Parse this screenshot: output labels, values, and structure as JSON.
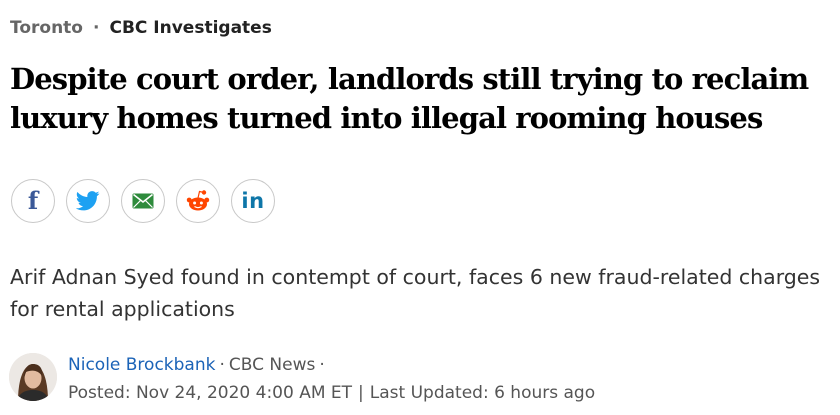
{
  "breadcrumb": {
    "region": "Toronto",
    "separator": "·",
    "section": "CBC Investigates"
  },
  "headline": "Despite court order, landlords still trying to reclaim luxury homes turned into illegal rooming houses",
  "share": {
    "buttons": [
      {
        "name": "facebook",
        "icon": "facebook-icon",
        "color": "#3b5998"
      },
      {
        "name": "twitter",
        "icon": "twitter-icon",
        "color": "#1da1f2"
      },
      {
        "name": "email",
        "icon": "email-icon",
        "color": "#2e8b3c"
      },
      {
        "name": "reddit",
        "icon": "reddit-icon",
        "color": "#ff4500"
      },
      {
        "name": "linkedin",
        "icon": "linkedin-icon",
        "color": "#0e76a8"
      }
    ]
  },
  "deck": "Arif Adnan Syed found in contempt of court, faces 6 new fraud-related charges for rental applications",
  "byline": {
    "author": "Nicole Brockbank",
    "separator": "·",
    "outlet": "CBC News",
    "outlet_separator": "·",
    "posted": "Posted: Nov 24, 2020 4:00 AM ET",
    "pipe": "|",
    "updated": "Last Updated: 6 hours ago"
  },
  "colors": {
    "link": "#1b63b7",
    "headline": "#000000",
    "muted": "#666666"
  }
}
